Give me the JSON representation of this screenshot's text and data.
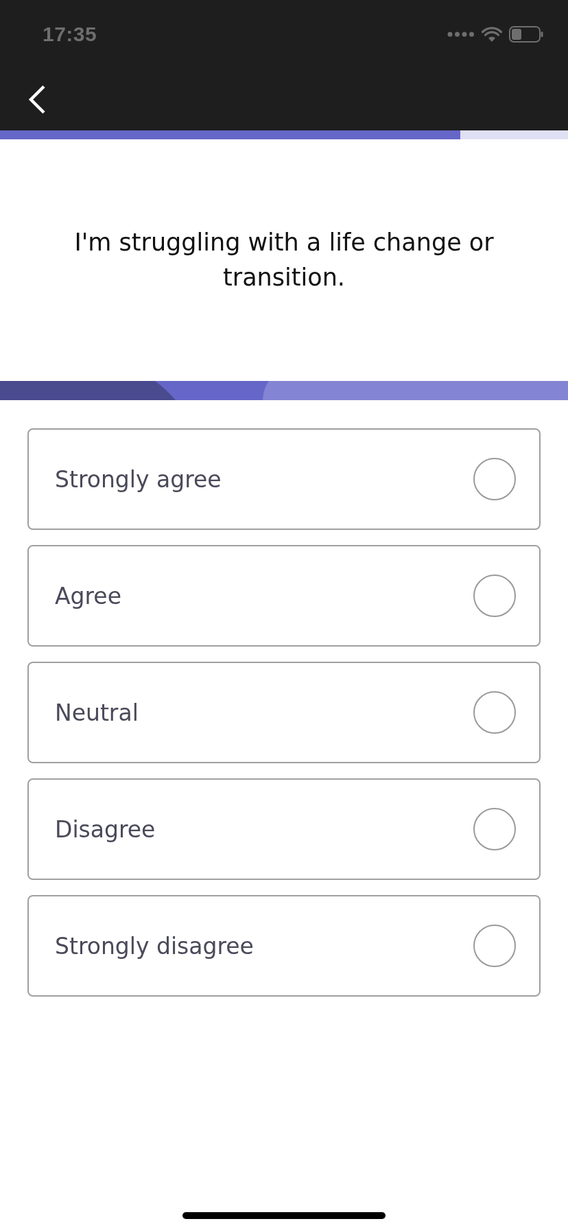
{
  "status_bar": {
    "time": "17:35"
  },
  "progress": {
    "level": 0.81
  },
  "question": "I'm struggling with a life change or transition.",
  "options": [
    {
      "label": "Strongly agree",
      "selected": false
    },
    {
      "label": "Agree",
      "selected": false
    },
    {
      "label": "Neutral",
      "selected": false
    },
    {
      "label": "Disagree",
      "selected": false
    },
    {
      "label": "Strongly disagree",
      "selected": false
    }
  ]
}
